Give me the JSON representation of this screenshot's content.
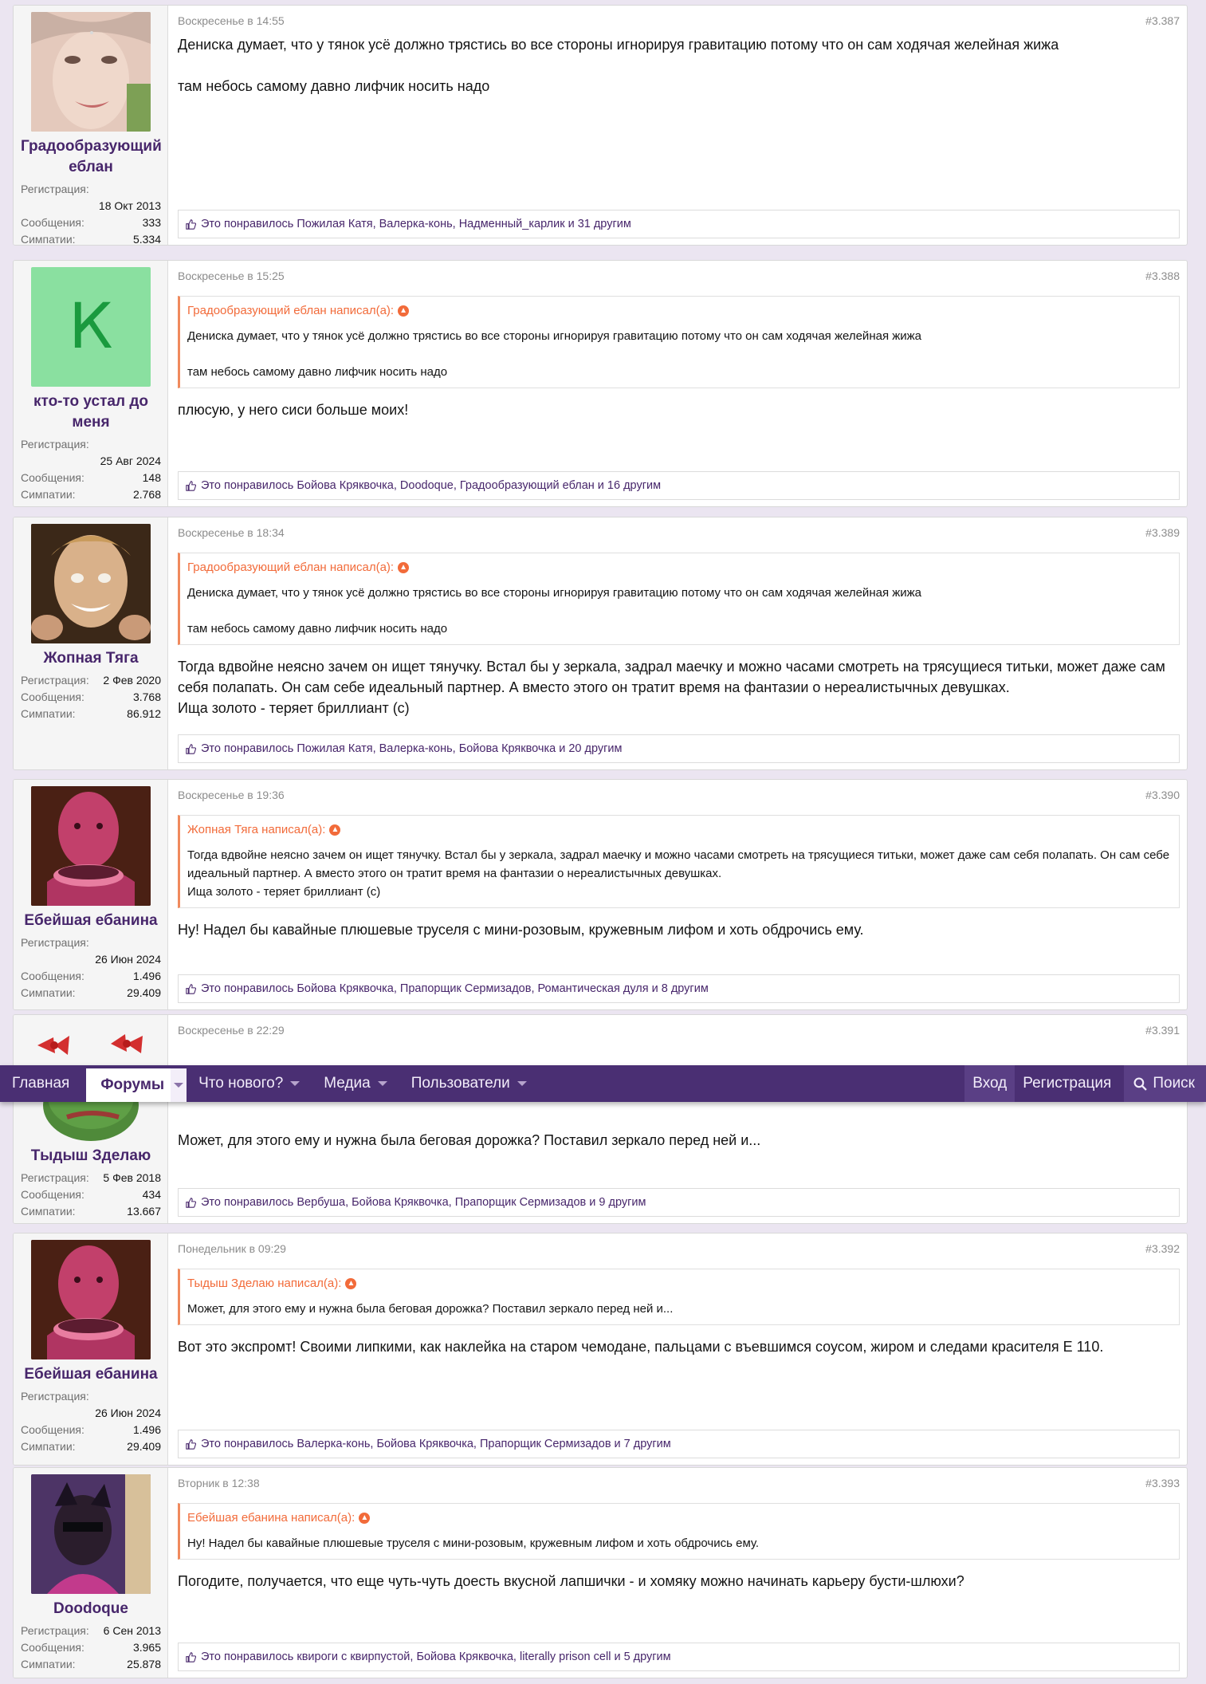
{
  "nav": {
    "items": [
      {
        "label": "Главная"
      },
      {
        "label": "Форумы"
      },
      {
        "label": "Что нового?"
      },
      {
        "label": "Медиа"
      },
      {
        "label": "Пользователи"
      }
    ],
    "login": "Вход",
    "register": "Регистрация",
    "search": "Поиск"
  },
  "labels": {
    "reg": "Регистрация:",
    "msgs": "Сообщения:",
    "likes": "Симпатии:"
  },
  "posts": [
    {
      "user": "Градообразующий еблан",
      "avatar_icon": "user-photo-icon",
      "reg": "18 Окт 2013",
      "msgs": "333",
      "likes": "5.334",
      "date": "Воскресенье в 14:55",
      "num": "#3.387",
      "body1": "Дениска думает, что у тянок усё должно трястись во все стороны игнорируя гравитацию потому что он сам ходячая желейная жижа",
      "body2": "там небось самому давно лифчик носить надо",
      "liked": "Это понравилось Пожилая Катя, Валерка-конь, Надменный_карлик и 31 другим"
    },
    {
      "user": "кто-то устал до меня",
      "avatar_letter": "К",
      "reg": "25 Авг 2024",
      "msgs": "148",
      "likes": "2.768",
      "date": "Воскресенье в 15:25",
      "num": "#3.388",
      "quote_head": "Градообразующий еблан написал(а):",
      "quote1": "Дениска думает, что у тянок усё должно трястись во все стороны игнорируя гравитацию потому что он сам ходячая желейная жижа",
      "quote2": "там небось самому давно лифчик носить надо",
      "body1": "плюсую, у него сиси больше моих!",
      "liked": "Это понравилось Бойова Кряквочка, Doodoque, Градообразующий еблан и 16 другим"
    },
    {
      "user": "Жопная Тяга",
      "reg": "2 Фев 2020",
      "msgs": "3.768",
      "likes": "86.912",
      "date": "Воскресенье в 18:34",
      "num": "#3.389",
      "quote_head": "Градообразующий еблан написал(а):",
      "quote1": "Дениска думает, что у тянок усё должно трястись во все стороны игнорируя гравитацию потому что он сам ходячая желейная жижа",
      "quote2": "там небось самому давно лифчик носить надо",
      "body1": "Тогда вдвойне неясно зачем он ищет тянучку. Встал бы у зеркала, задрал маечку и можно часами смотреть на трясущиеся титьки, может даже сам себя полапать. Он сам себе идеальный партнер. А вместо этого он тратит время на фантазии о нереалистычных девушках.",
      "body2": "Ища золото - теряет бриллиант (с)",
      "liked": "Это понравилось Пожилая Катя, Валерка-конь, Бойова Кряквочка и 20 другим"
    },
    {
      "user": "Ебейшая ебанина",
      "reg": "26 Июн 2024",
      "msgs": "1.496",
      "likes": "29.409",
      "date": "Воскресенье в 19:36",
      "num": "#3.390",
      "quote_head": "Жопная Тяга написал(а):",
      "quote1": "Тогда вдвойне неясно зачем он ищет тянучку. Встал бы у зеркала, задрал маечку и можно часами смотреть на трясущиеся титьки, может даже сам себя полапать. Он сам себе идеальный партнер. А вместо этого он тратит время на фантазии о нереалистычных девушках.",
      "quote2": "Ища золото - теряет бриллиант (с)",
      "body1": "Ну! Надел бы кавайные плюшевые труселя с мини-розовым, кружевным лифом и хоть обдрочись ему.",
      "liked": "Это понравилось Бойова Кряквочка, Прапорщик Сермизадов, Романтическая дуля и 8 другим"
    },
    {
      "user": "Тыдыш Зделаю",
      "reg": "5 Фев 2018",
      "msgs": "434",
      "likes": "13.667",
      "date": "Воскресенье в 22:29",
      "num": "#3.391",
      "body1": "Может, для этого ему и нужна была беговая дорожка? Поставил зеркало перед ней и...",
      "liked": "Это понравилось Вербуша, Бойова Кряквочка, Прапорщик Сермизадов и 9 другим"
    },
    {
      "user": "Ебейшая ебанина",
      "reg": "26 Июн 2024",
      "msgs": "1.496",
      "likes": "29.409",
      "date": "Понедельник в 09:29",
      "num": "#3.392",
      "quote_head": "Тыдыш Зделаю написал(а):",
      "quote1": "Может, для этого ему и нужна была беговая дорожка? Поставил зеркало перед ней и...",
      "body1": "Вот это экспромт! Своими липкими, как наклейка на старом чемодане, пальцами с въевшимся соусом, жиром и следами красителя Е 110.",
      "liked": "Это понравилось Валерка-конь, Бойова Кряквочка, Прапорщик Сермизадов и 7 другим"
    },
    {
      "user": "Doodoque",
      "reg": "6 Сен 2013",
      "msgs": "3.965",
      "likes": "25.878",
      "date": "Вторник в 12:38",
      "num": "#3.393",
      "quote_head": "Ебейшая ебанина написал(а):",
      "quote1": "Ну! Надел бы кавайные плюшевые труселя с мини-розовым, кружевным лифом и хоть обдрочись ему.",
      "body1": "Погодите, получается, что еще чуть-чуть доесть вкусной лапшички - и хомяку можно начинать карьеру бусти-шлюхи?",
      "liked": "Это понравилось квироги с квирпустой, Бойова Кряквочка, literally prison cell и 5 другим"
    }
  ],
  "colors": {
    "brand": "#4a2f73",
    "username": "#47266b",
    "quote_accent": "#f26b3a",
    "background": "#ebe5f1"
  }
}
